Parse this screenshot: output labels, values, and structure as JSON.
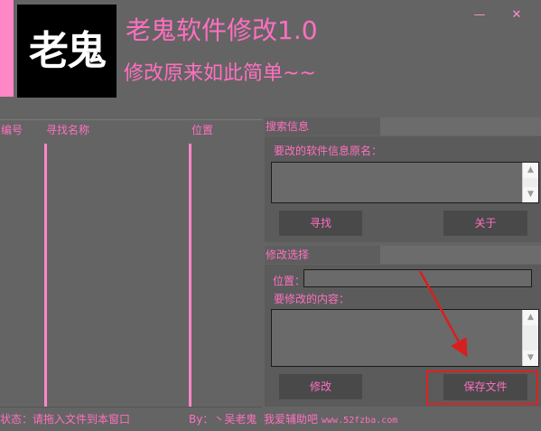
{
  "header": {
    "logo_text": "老鬼",
    "title": "老鬼软件修改1.0",
    "subtitle": "修改原来如此简单~~",
    "minimize_glyph": "—",
    "close_glyph": "✕"
  },
  "results": {
    "columns": [
      "编号",
      "寻找名称",
      "位置"
    ],
    "rows": []
  },
  "search_section": {
    "header": "搜索信息",
    "original_name_label": "要改的软件信息原名：",
    "original_name_value": "",
    "find_label": "寻找",
    "about_label": "关于"
  },
  "modify_section": {
    "header": "修改选择",
    "position_label": "位置：",
    "position_value": "",
    "content_label": "要修改的内容：",
    "content_value": "",
    "modify_label": "修改",
    "save_label": "保存文件"
  },
  "status_bar": {
    "status": "状态：请拖入文件到本窗口",
    "author": "By：丶吴老鬼",
    "site_name": "我爱辅助吧",
    "site_url": "www.52fzba.com"
  },
  "colors": {
    "background": "#646464",
    "accent_pink": "#ff6fc0",
    "annotation_red": "#e02020"
  },
  "icons": {
    "scroll_up": "triangle-up-icon",
    "scroll_down": "triangle-down-icon"
  }
}
